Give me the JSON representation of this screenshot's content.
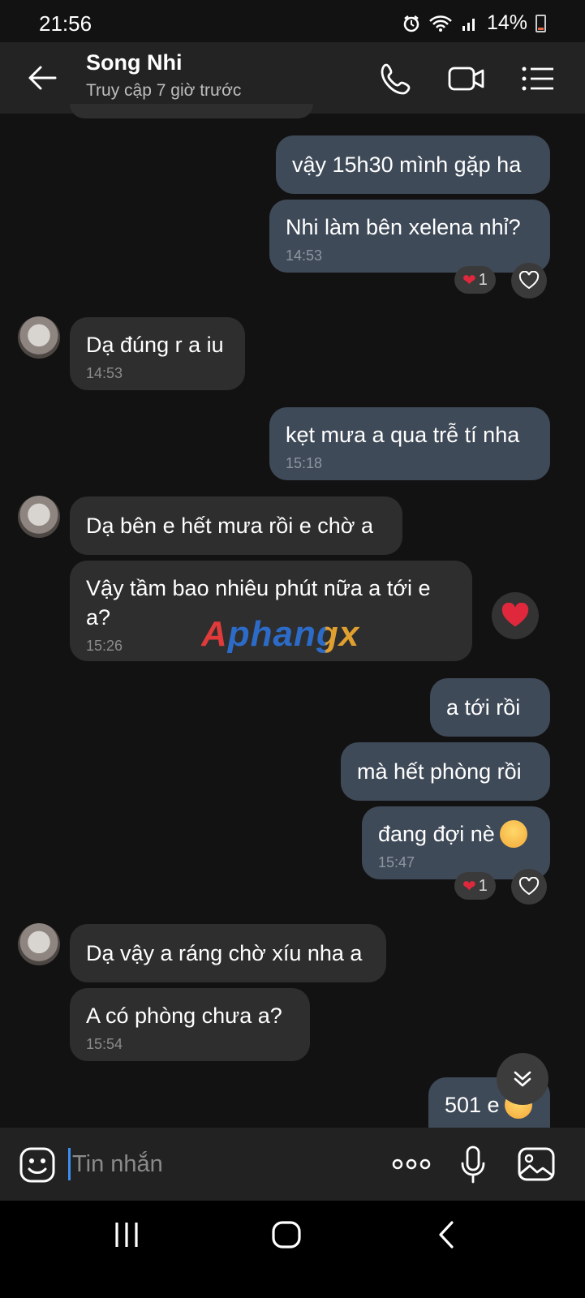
{
  "status_bar": {
    "time": "21:56",
    "battery": "14%"
  },
  "header": {
    "name": "Song Nhi",
    "status": "Truy cập 7 giờ trước"
  },
  "messages": {
    "m1": {
      "text": "vậy 15h30 mình gặp ha"
    },
    "m2": {
      "text": "Nhi làm bên xelena nhỉ?",
      "time": "14:53",
      "reaction_count": "1"
    },
    "m3": {
      "text": "Dạ đúng r a iu",
      "time": "14:53"
    },
    "m4": {
      "text": "kẹt mưa a qua trễ tí nha",
      "time": "15:18"
    },
    "m5": {
      "text": "Dạ bên e hết mưa rồi e chờ a"
    },
    "m6": {
      "text": "Vậy tầm bao nhiêu phút nữa a tới e a?",
      "time": "15:26"
    },
    "m7": {
      "text": "a tới rồi"
    },
    "m8": {
      "text": "mà hết phòng rồi"
    },
    "m9": {
      "text": "đang đợi nè",
      "time": "15:47",
      "reaction_count": "1"
    },
    "m10": {
      "text": "Dạ vậy a ráng chờ xíu nha a"
    },
    "m11": {
      "text": "A có phòng chưa a?",
      "time": "15:54"
    },
    "m12": {
      "text": "501 e"
    }
  },
  "watermark": "Aphangx",
  "input": {
    "placeholder": "Tin nhắn"
  },
  "colors": {
    "outgoing_bubble": "#3f4a58",
    "incoming_bubble": "#2e2e2e",
    "background": "#121212",
    "heart": "#e0283c",
    "caret": "#3d8ef0"
  }
}
